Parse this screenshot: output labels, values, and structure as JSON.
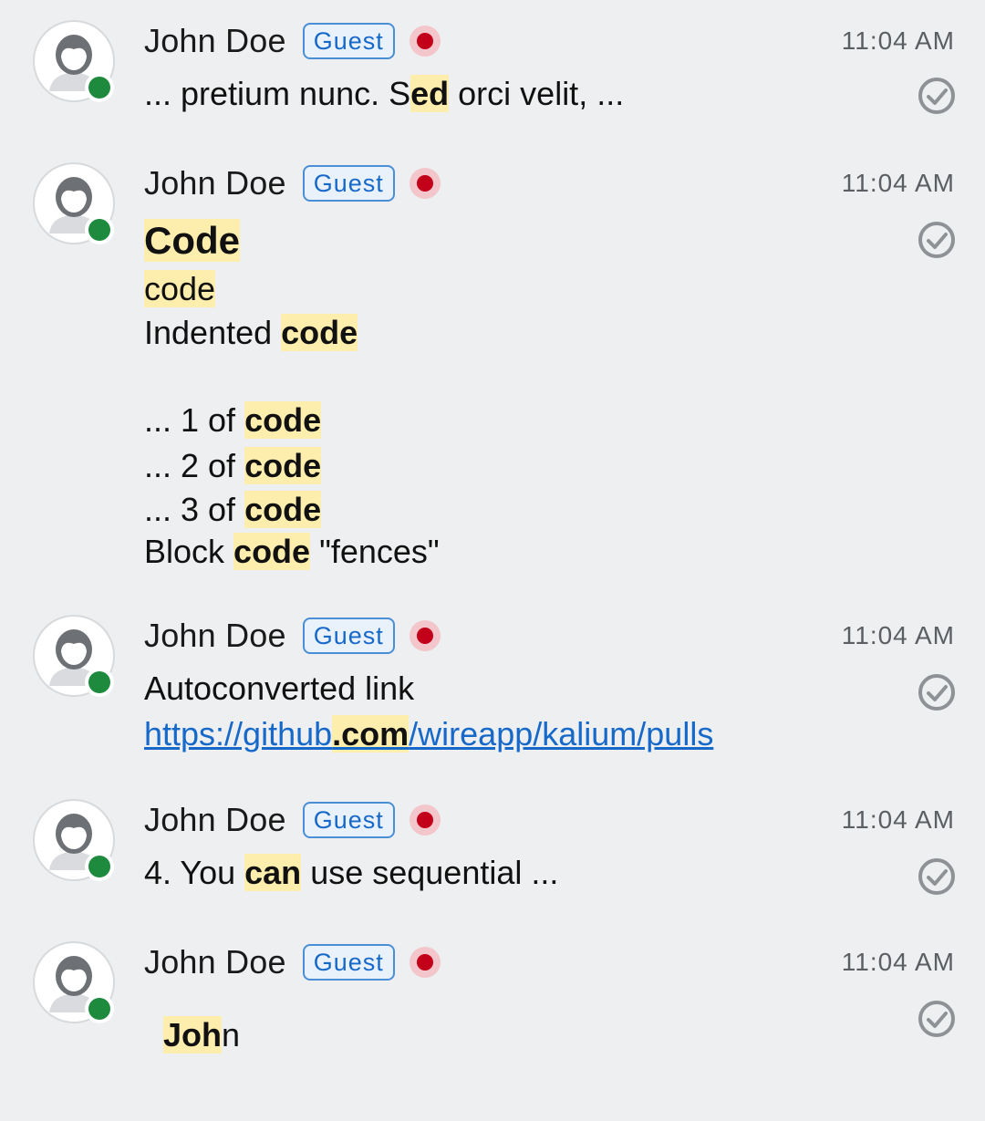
{
  "messages": [
    {
      "sender": "John Doe",
      "badge": "Guest",
      "time": "11:04 AM",
      "lines": [
        [
          "... pretium nunc. S",
          "ed",
          " orci velit, ..."
        ]
      ]
    },
    {
      "sender": "John Doe",
      "badge": "Guest",
      "time": "11:04 AM",
      "heading": "Code",
      "lines": [
        [
          "",
          "code",
          ""
        ],
        [
          "Indented ",
          "code",
          ""
        ],
        [
          "",
          "",
          ""
        ],
        [
          "... 1 of ",
          "code",
          ""
        ],
        [
          "... 2 of ",
          "code",
          ""
        ],
        [
          "... 3 of ",
          "code",
          ""
        ],
        [
          "Block ",
          "code",
          " \"fences\""
        ]
      ]
    },
    {
      "sender": "John Doe",
      "badge": "Guest",
      "time": "11:04 AM",
      "text": "Autoconverted link",
      "link": [
        "https://github",
        ".com",
        "/wireapp/kalium/pulls"
      ]
    },
    {
      "sender": "John Doe",
      "badge": "Guest",
      "time": "11:04 AM",
      "lines": [
        [
          "4. You ",
          "can",
          " use sequential ..."
        ]
      ]
    },
    {
      "sender": "John Doe",
      "badge": "Guest",
      "time": "11:04 AM",
      "lines": [
        [
          "",
          "Joh",
          "n"
        ]
      ]
    }
  ],
  "icons": {
    "avatar": "default-user-avatar-icon",
    "presence": "online-status-dot",
    "legal_hold": "legal-hold-indicator-icon",
    "delivery": "message-delivered-check-icon"
  },
  "colors": {
    "background": "#edeff0",
    "highlight": "#fdeeae",
    "guest_badge": "#1668c9",
    "online": "#1e8a3e",
    "legal_hold": "#c2001a",
    "link": "#1668c9"
  }
}
